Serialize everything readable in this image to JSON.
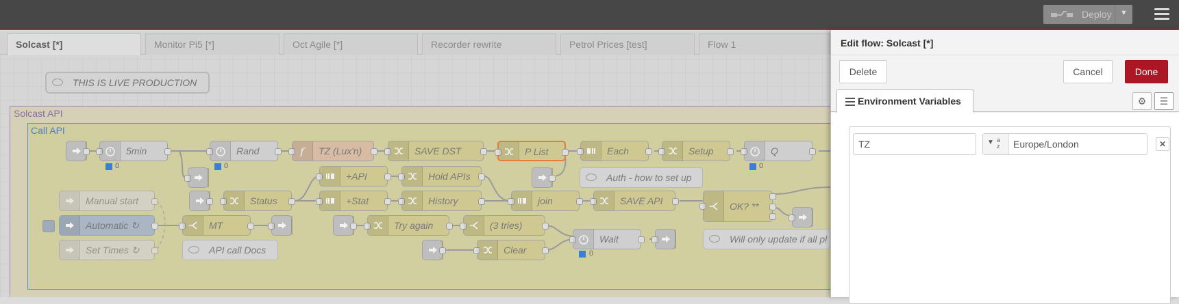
{
  "header": {
    "deploy_label": "Deploy",
    "deploy_icon": "deploy-icon",
    "menu_icon": "hamburger-menu-icon"
  },
  "tabs": [
    "Solcast [*]",
    "Monitor Pi5 [*]",
    "Oct Agile [*]",
    "Recorder rewrite",
    "Petrol Prices [test]",
    "Flow 1"
  ],
  "active_tab": "Solcast [*]",
  "canvas": {
    "top_comment": "THIS IS LIVE PRODUCTION",
    "group_outer": "Solcast API",
    "group_inner": "Call API",
    "nodes": {
      "n5min": "5min",
      "rand": "Rand",
      "tz": "TZ (Lux'n)",
      "save_dst": "SAVE DST",
      "p_list": "P List",
      "each": "Each",
      "setup": "Setup",
      "q": "Q",
      "plus_api": "+API",
      "hold_apis": "Hold APIs",
      "auth": "Auth - how to set up",
      "manual_start": "Manual start",
      "status": "Status",
      "plus_stat": "+Stat",
      "history": "History",
      "join": "join",
      "save_api": "SAVE API",
      "ok": "OK? **",
      "automatic": "Automatic ↻",
      "mt": "MT",
      "try_again": "Try again",
      "three_tries": "(3 tries)",
      "wait": "Wait",
      "will_update": "Will only update if all pl",
      "set_times": "Set Times ↻",
      "api_docs": "API call Docs",
      "clear": "Clear"
    },
    "counters": {
      "c5min": "0",
      "crand": "0",
      "cq": "0",
      "cwait": "0"
    },
    "colors": {
      "function": "#d7bca3",
      "change": "#cfc890",
      "selected_border": "#e07e3a",
      "inject_blue": "#aab6c4"
    }
  },
  "panel": {
    "title_prefix": "Edit flow:",
    "title_name": "Solcast [*]",
    "delete_label": "Delete",
    "cancel_label": "Cancel",
    "done_label": "Done",
    "done_color": "#ad1625",
    "tab_label": "Environment Variables",
    "settings_icon": "gear-icon",
    "list_icon": "list-icon",
    "env": [
      {
        "name": "TZ",
        "type_icon": "string-az-icon",
        "value": "Europe/London"
      }
    ]
  }
}
